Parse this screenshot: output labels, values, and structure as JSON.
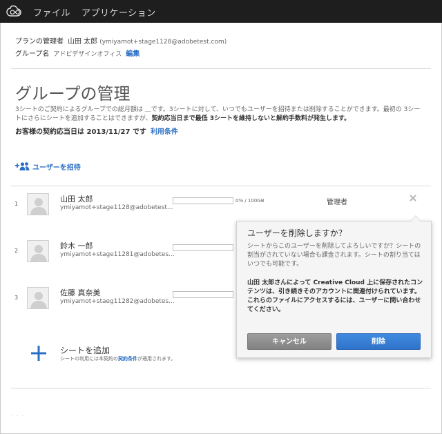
{
  "topbar": {
    "logo": "creative-cloud-logo",
    "nav": [
      {
        "label": "ファイル"
      },
      {
        "label": "アプリケーション"
      }
    ]
  },
  "plan": {
    "admin_label": "プランの管理者",
    "admin_name": "山田 太郎",
    "admin_email": "(ymiyamot+stage1128@adobetest.com)",
    "group_label": "グループ名",
    "group_name": "アドビデザインオフィス",
    "edit_link": "編集"
  },
  "page_title": "グループの管理",
  "description": {
    "line1": "3シートのご契約によるグループでの総月額は ＿です。3シートに対して、いつでもユーザーを招待または削除することができます。最初の 3シー",
    "line2_pre": "トにさらにシートを追加することはできますが、",
    "line2_bold": "契約応当日まで最低 3シートを維持しないと解約手数料が発生します。"
  },
  "renewal": {
    "text": "お客様の契約応当日は 2013/11/27 です",
    "terms_link": "利用条件"
  },
  "invite_button": "ユーザーを招待",
  "users": [
    {
      "index": "1",
      "name": "山田 太郎",
      "email": "ymiyamot+stage1128@adobetest...",
      "usage": "0% / 100GB",
      "role": "管理者"
    },
    {
      "index": "2",
      "name": "鈴木 一郎",
      "email": "ymiyamot+stage11281@adobetes..."
    },
    {
      "index": "3",
      "name": "佐藤 真奈美",
      "email": "ymiyamot+staeg11282@adobetes..."
    }
  ],
  "add_seat": {
    "title": "シートを追加",
    "note_pre": "シートの利用には本契約の",
    "note_link": "契約条件",
    "note_post": "が適用されます。"
  },
  "bottom_dots": "· · ·",
  "dialog": {
    "title": "ユーザーを削除しますか？",
    "body": "シートからこのユーザーを削除してよろしいですか？シートの割当がされていない場合も課金されます。シートの割り当てはいつでも可能です。",
    "warning": "山田 太郎さんによって Creative Cloud 上に保存されたコンテンツは、引き続きそのアカウントに関連付けられています。これらのファイルにアクセスするには、ユーザーに問い合わせてください。",
    "cancel_label": "キャンセル",
    "delete_label": "削除"
  },
  "colors": {
    "topbar": "#1e1e1e",
    "link": "#2a6fc4",
    "delete_button": "#2f73c9",
    "cancel_button": "#8a8a8a"
  }
}
